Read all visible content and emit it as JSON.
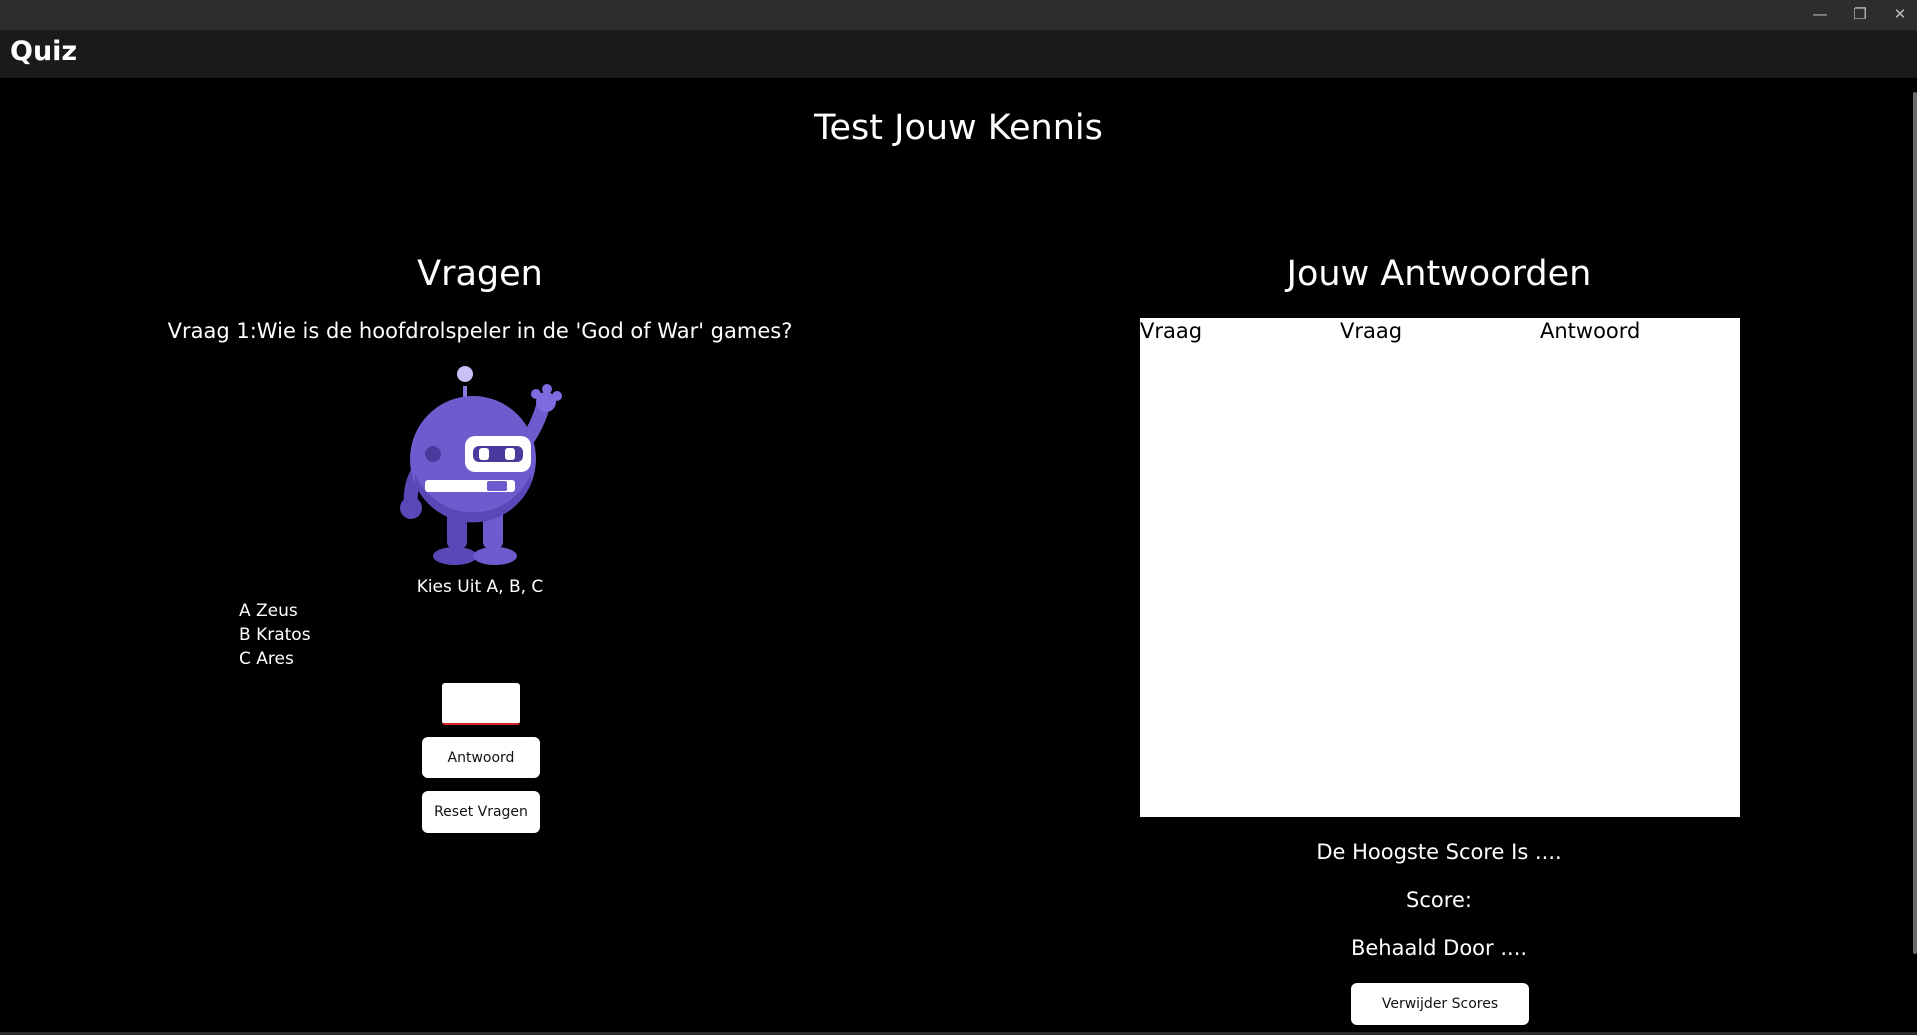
{
  "window": {
    "minimize_glyph": "—",
    "maximize_glyph": "❐",
    "close_glyph": "✕"
  },
  "app": {
    "title": "Quiz"
  },
  "main": {
    "title": "Test Jouw Kennis"
  },
  "questions_panel": {
    "heading": "Vragen",
    "question": "Vraag 1:Wie is de hoofdrolspeler in de 'God of War' games?",
    "image_icon": "dotnet-bot-icon",
    "instruction": "Kies Uit A, B, C",
    "options": [
      "A Zeus",
      "B Kratos",
      "C Ares"
    ],
    "answer_input_value": "",
    "answer_button": "Antwoord",
    "reset_button": "Reset Vragen"
  },
  "answers_panel": {
    "heading": "Jouw Antwoorden",
    "columns": [
      "Vraag",
      "Vraag",
      "Antwoord"
    ],
    "rows": [],
    "highscore_label": "De Hoogste Score Is ....",
    "score_label": "Score:",
    "achieved_by_label": "Behaald Door ....",
    "delete_button": "Verwijder Scores"
  },
  "colors": {
    "background": "#000000",
    "titlebar": "#2d2d2d",
    "appbar": "#1a1a1a",
    "bot_purple": "#6e5ccf",
    "input_underline": "#d6262a"
  }
}
